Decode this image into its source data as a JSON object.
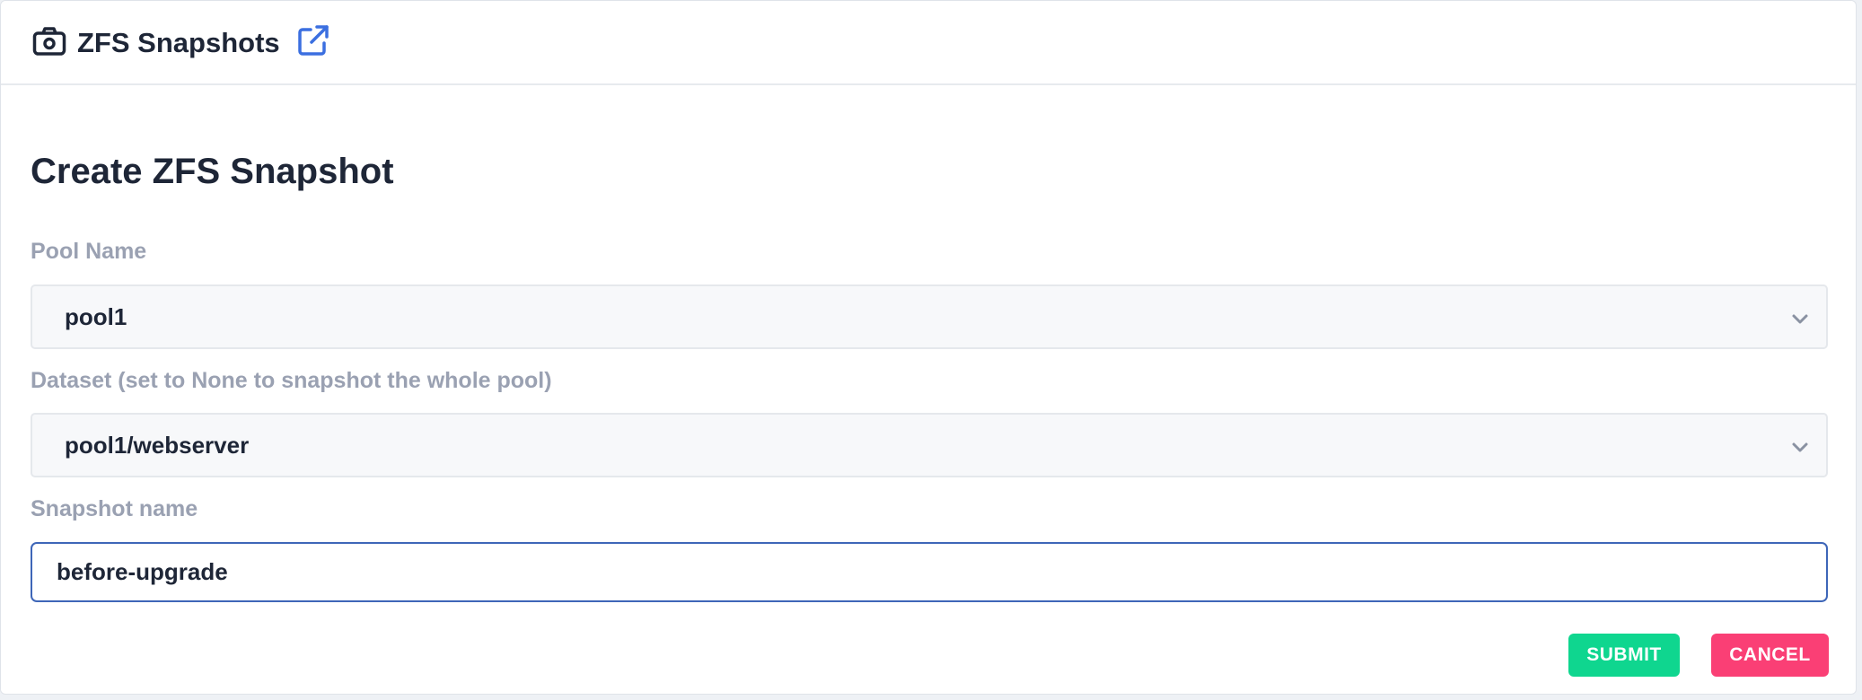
{
  "header": {
    "title": "ZFS Snapshots",
    "camera_icon": "camera-icon",
    "external_link_icon": "external-link-icon",
    "accent_color": "#3b6fe0"
  },
  "form": {
    "title": "Create ZFS Snapshot",
    "pool": {
      "label": "Pool Name",
      "value": "pool1"
    },
    "dataset": {
      "label": "Dataset (set to None to snapshot the whole pool)",
      "value": "pool1/webserver"
    },
    "snapshot": {
      "label": "Snapshot name",
      "value": "before-upgrade"
    },
    "submit_label": "SUBMIT",
    "cancel_label": "CANCEL",
    "submit_color": "#0fd68f",
    "cancel_color": "#fa3f75"
  }
}
